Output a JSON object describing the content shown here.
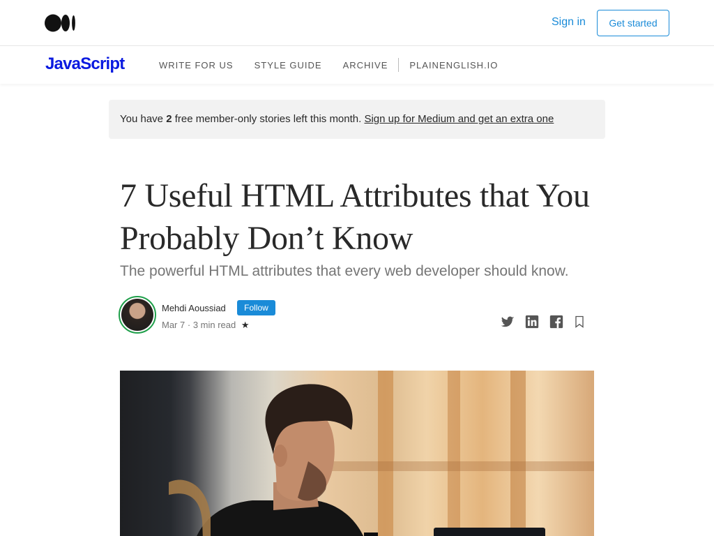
{
  "header": {
    "logo_icon": "medium-logo-icon",
    "sign_in_label": "Sign in",
    "get_started_label": "Get started"
  },
  "publication": {
    "name": "JavaScript",
    "nav": [
      {
        "label": "WRITE FOR US"
      },
      {
        "label": "STYLE GUIDE"
      },
      {
        "label": "ARCHIVE"
      },
      {
        "label": "PLAINENGLISH.IO"
      }
    ]
  },
  "banner": {
    "prefix": "You have ",
    "count": "2",
    "suffix": " free member-only stories left this month. ",
    "link": "Sign up for Medium and get an extra one"
  },
  "article": {
    "title": "7 Useful HTML Attributes that You Probably Don’t Know",
    "subtitle": "The powerful HTML attributes that every web developer should know.",
    "author": "Mehdi Aoussiad",
    "follow_label": "Follow",
    "date": "Mar 7",
    "dot": "·",
    "read_time": "3 min read",
    "member_star": "★"
  },
  "share_icons": [
    "twitter-icon",
    "linkedin-icon",
    "facebook-icon",
    "bookmark-icon"
  ],
  "colors": {
    "accent": "#1a8bd8",
    "publication": "#0a1ae0",
    "avatar_ring": "#1f9f4a"
  }
}
